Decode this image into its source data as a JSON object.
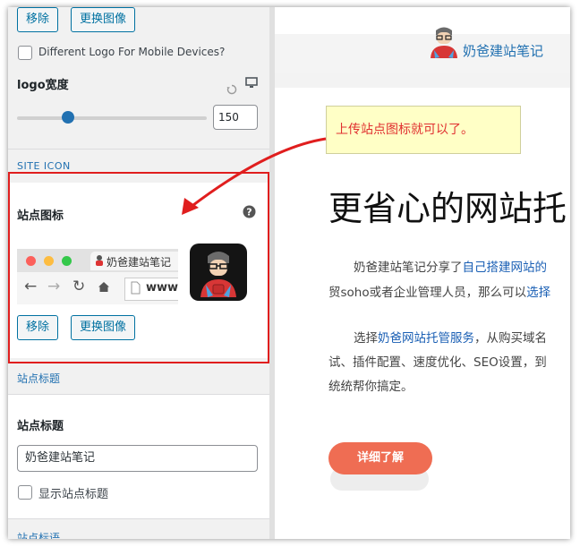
{
  "logo": {
    "remove_button": "移除",
    "replace_button": "更换图像",
    "mobile_checkbox_label": "Different Logo For Mobile Devices?",
    "width_label": "logo宽度",
    "width_value": "150",
    "slider_level": 0.27
  },
  "site_icon": {
    "section_link": "SITE ICON",
    "heading": "站点图标",
    "browser_tab_text": "奶爸建站笔记",
    "address_text": "www.",
    "remove_button": "移除",
    "replace_button": "更换图像"
  },
  "site_title": {
    "section_link": "站点标题",
    "heading": "站点标题",
    "input_value": "奶爸建站笔记",
    "show_checkbox_label": "显示站点标题",
    "bottom_link": "站点标语"
  },
  "preview": {
    "site_name": "奶爸建站笔记",
    "big_title": "更省心的网站托",
    "para1_line1_prefix": "奶爸建站笔记分享了",
    "para1_line1_link": "自己搭建网站的",
    "para1_line2_prefix": "贸soho或者企业管理人员，那么可以",
    "para1_line2_link": "选择",
    "para2_line1_prefix": "选择",
    "para2_line1_link": "奶爸网站托管服务",
    "para2_line1_suffix": "，从购买域名",
    "para2_line2": "试、插件配置、速度优化、SEO设置，到",
    "para2_line3": "统统帮你搞定。",
    "cta_button": "详细了解"
  },
  "annotation": {
    "callout_text": "上传站点图标就可以了。",
    "accent_color": "#e01e1e"
  }
}
